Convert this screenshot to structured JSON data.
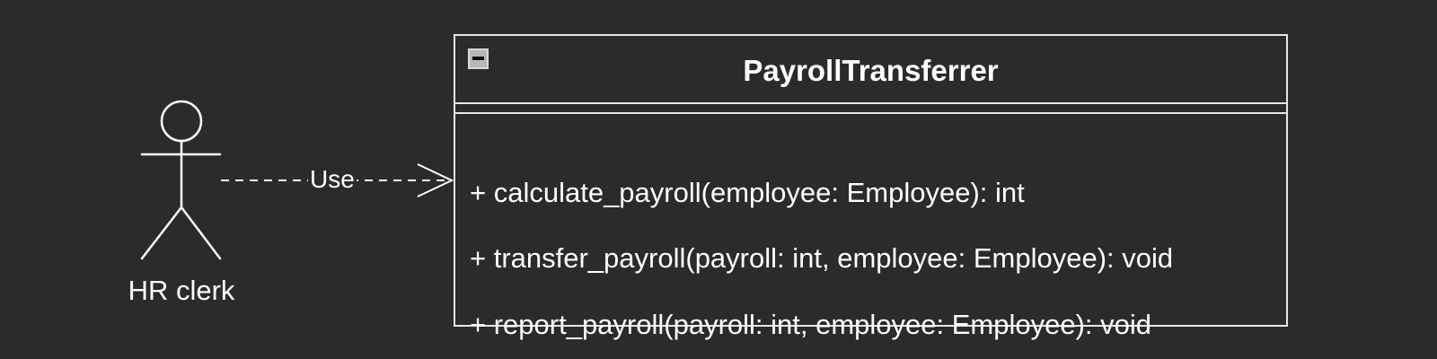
{
  "actor": {
    "name": "HR clerk"
  },
  "relationship": {
    "label": "Use",
    "style": "dashed",
    "arrowhead": "open"
  },
  "class": {
    "name": "PayrollTransferrer",
    "attributes": [],
    "methods": [
      "+ calculate_payroll(employee: Employee): int",
      "+ transfer_payroll(payroll: int, employee: Employee): void",
      "+ report_payroll(payroll: int, employee: Employee): void"
    ]
  },
  "colors": {
    "background": "#2b2b2b",
    "stroke": "#e6e6e6",
    "text": "#ffffff"
  }
}
